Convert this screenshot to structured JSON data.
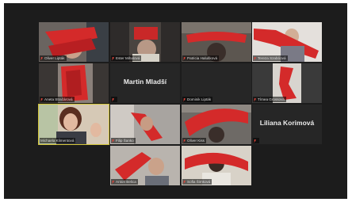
{
  "colors": {
    "background": "#1c1c1c",
    "tile": "#2a2a2a",
    "active_speaker_border": "#d4c63a",
    "muted_icon": "#e0453b",
    "scarf": "#d42a2a"
  },
  "participants": [
    {
      "name": "Oliver Lipták",
      "video": true,
      "muted": true
    },
    {
      "name": "Ester Mihalová",
      "video": true,
      "muted": true
    },
    {
      "name": "Patricia Halušková",
      "video": true,
      "muted": true
    },
    {
      "name": "Tereza Szabóová",
      "video": true,
      "muted": true
    },
    {
      "name": "Aneta Stračárová",
      "video": true,
      "muted": true
    },
    {
      "name": "",
      "display_name": "Martin Mladší",
      "video": false,
      "muted": true
    },
    {
      "name": "Dominik Lipták",
      "video": false,
      "muted": true
    },
    {
      "name": "Tímea Grossová",
      "video": true,
      "muted": true
    },
    {
      "name": "Michaela Klimentová",
      "video": true,
      "muted": false,
      "active": true
    },
    {
      "name": "Filip Šanko",
      "video": true,
      "muted": true
    },
    {
      "name": "Oliver Kiss",
      "video": true,
      "muted": true
    },
    {
      "name": "",
      "display_name": "Liliana Korimová",
      "video": false,
      "muted": true
    },
    {
      "name": "Anton Belica",
      "video": true,
      "muted": true
    },
    {
      "name": "Sofia Šimková",
      "video": true,
      "muted": true
    }
  ]
}
